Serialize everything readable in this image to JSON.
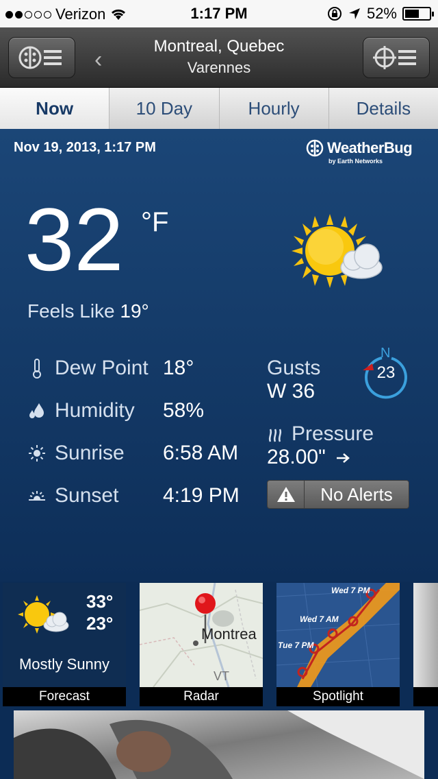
{
  "status_bar": {
    "carrier": "Verizon",
    "time": "1:17 PM",
    "battery": "52%"
  },
  "header": {
    "city": "Montreal, Quebec",
    "station": "Varennes"
  },
  "tabs": [
    {
      "label": "Now",
      "active": true
    },
    {
      "label": "10 Day"
    },
    {
      "label": "Hourly"
    },
    {
      "label": "Details"
    }
  ],
  "main": {
    "datetime": "Nov 19, 2013, 1:17 PM",
    "brand": {
      "name": "WeatherBug",
      "by": "by Earth Networks"
    },
    "temperature": "32",
    "unit": "°F",
    "feels_label": "Feels Like",
    "feels_value": "19°",
    "dew_point": {
      "label": "Dew Point",
      "value": "18°"
    },
    "humidity": {
      "label": "Humidity",
      "value": "58%"
    },
    "sunrise": {
      "label": "Sunrise",
      "value": "6:58 AM"
    },
    "sunset": {
      "label": "Sunset",
      "value": "4:19 PM"
    },
    "gusts": {
      "label": "Gusts",
      "value": "W 36"
    },
    "wind": {
      "direction": "N",
      "speed": "23"
    },
    "pressure": {
      "label": "Pressure",
      "value": "28.00\""
    },
    "alerts": "No Alerts"
  },
  "tiles": {
    "forecast": {
      "hi": "33°",
      "lo": "23°",
      "condition": "Mostly Sunny",
      "caption": "Forecast"
    },
    "radar": {
      "caption": "Radar",
      "map_label": "Montrea",
      "map_label2": "VT"
    },
    "spotlight": {
      "caption": "Spotlight",
      "labels": [
        "Wed 7 PM",
        "Wed 7 AM",
        "Tue 7 PM"
      ]
    }
  }
}
